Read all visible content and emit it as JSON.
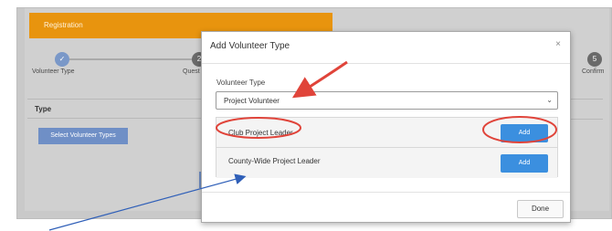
{
  "background": {
    "tab_label": "Registration",
    "steps": [
      {
        "number": "",
        "label": "Volunteer Type"
      },
      {
        "number": "2",
        "label": "Quest"
      },
      {
        "number": "5",
        "label": "Confirm"
      }
    ],
    "table_header": "Type",
    "select_button_label": "Select Volunteer Types"
  },
  "modal": {
    "title": "Add Volunteer Type",
    "close_glyph": "×",
    "field_label": "Volunteer Type",
    "select_value": "Project Volunteer",
    "select_chevron": "⌄",
    "rows": [
      {
        "label": "Club Project Leader",
        "button": "Add"
      },
      {
        "label": "County-Wide Project Leader",
        "button": "Add"
      }
    ],
    "done_label": "Done"
  },
  "annotations": {
    "circle_color": "#e0443a",
    "arrow_red_color": "#e0443a",
    "arrow_blue_color": "#2f5fb8"
  }
}
